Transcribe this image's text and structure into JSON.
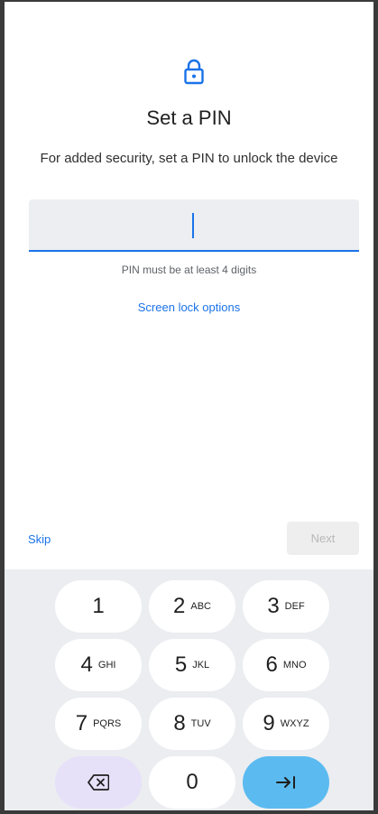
{
  "header": {
    "icon": "lock-icon",
    "title": "Set a PIN",
    "subtitle": "For added security, set a PIN to unlock the device"
  },
  "pin_input": {
    "value": "",
    "hint": "PIN must be at least 4 digits"
  },
  "links": {
    "screen_lock_options": "Screen lock options"
  },
  "footer": {
    "skip_label": "Skip",
    "next_label": "Next",
    "next_enabled": false
  },
  "keypad": {
    "keys": [
      {
        "digit": "1",
        "letters": ""
      },
      {
        "digit": "2",
        "letters": "ABC"
      },
      {
        "digit": "3",
        "letters": "DEF"
      },
      {
        "digit": "4",
        "letters": "GHI"
      },
      {
        "digit": "5",
        "letters": "JKL"
      },
      {
        "digit": "6",
        "letters": "MNO"
      },
      {
        "digit": "7",
        "letters": "PQRS"
      },
      {
        "digit": "8",
        "letters": "TUV"
      },
      {
        "digit": "9",
        "letters": "WXYZ"
      },
      {
        "digit": "0",
        "letters": ""
      }
    ],
    "backspace_icon": "backspace-icon",
    "enter_icon": "tab-arrow-icon"
  },
  "colors": {
    "accent": "#1a73e8",
    "backspace_key": "#e7e0f9",
    "enter_key": "#5bbbf0",
    "keyboard_bg": "#ebedf0"
  }
}
